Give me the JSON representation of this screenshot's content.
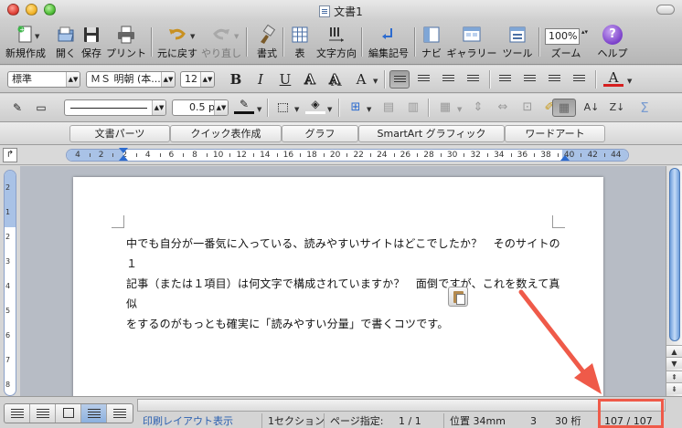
{
  "window": {
    "title": "文書1"
  },
  "toolbar": {
    "items": [
      {
        "label": "新規作成",
        "icon": "new-document-icon"
      },
      {
        "label": "開く",
        "icon": "open-folder-icon"
      },
      {
        "label": "保存",
        "icon": "save-icon"
      },
      {
        "label": "プリント",
        "icon": "print-icon"
      },
      {
        "label": "元に戻す",
        "icon": "undo-icon"
      },
      {
        "label": "やり直し",
        "icon": "redo-icon"
      },
      {
        "label": "書式",
        "icon": "format-brush-icon"
      },
      {
        "label": "表",
        "icon": "table-icon"
      },
      {
        "label": "文字方向",
        "icon": "text-direction-icon"
      },
      {
        "label": "編集記号",
        "icon": "edit-marks-icon"
      },
      {
        "label": "ナビ",
        "icon": "navigation-icon"
      },
      {
        "label": "ギャラリー",
        "icon": "gallery-icon"
      },
      {
        "label": "ツール",
        "icon": "toolbox-icon"
      },
      {
        "label": "ズーム",
        "icon": "zoom-icon"
      },
      {
        "label": "ヘルプ",
        "icon": "help-icon"
      }
    ],
    "zoom_value": "100%"
  },
  "format": {
    "style": "標準",
    "font": "ＭＳ 明朝 (本...",
    "size": "12",
    "bold": "B",
    "italic": "I",
    "underline": "U",
    "line_width": "0.5 pt"
  },
  "gallery_tabs": [
    "文書パーツ",
    "クイック表作成",
    "グラフ",
    "SmartArt グラフィック",
    "ワードアート"
  ],
  "ruler": {
    "numbers": [
      "4",
      "2",
      "2",
      "4",
      "6",
      "8",
      "10",
      "12",
      "14",
      "16",
      "18",
      "20",
      "22",
      "24",
      "26",
      "28",
      "30",
      "32",
      "34",
      "36",
      "38",
      "40",
      "42",
      "44"
    ]
  },
  "vruler": {
    "numbers": [
      "2",
      "1",
      "2",
      "3",
      "4",
      "5",
      "6",
      "7",
      "8"
    ]
  },
  "document": {
    "lines": [
      "中でも自分が一番気に入っている、読みやすいサイトはどこでしたか？　そのサイトの１",
      "記事（または１項目）は何文字で構成されていますか？　面倒ですが、これを数えて真似",
      "をするのがもっとも確実に「読みやすい分量」で書くコツです。"
    ]
  },
  "status": {
    "view": "印刷レイアウト表示",
    "section": "1セクション",
    "page_label": "ページ指定:",
    "page_value": "1 / 1",
    "position": "位置 34mm",
    "line": "3",
    "column": "30 桁",
    "word_count": "107 / 107"
  },
  "colors": {
    "annotation": "#ef5a49",
    "thumb": "#6f9fdc",
    "font_color": "#d61f1f"
  }
}
